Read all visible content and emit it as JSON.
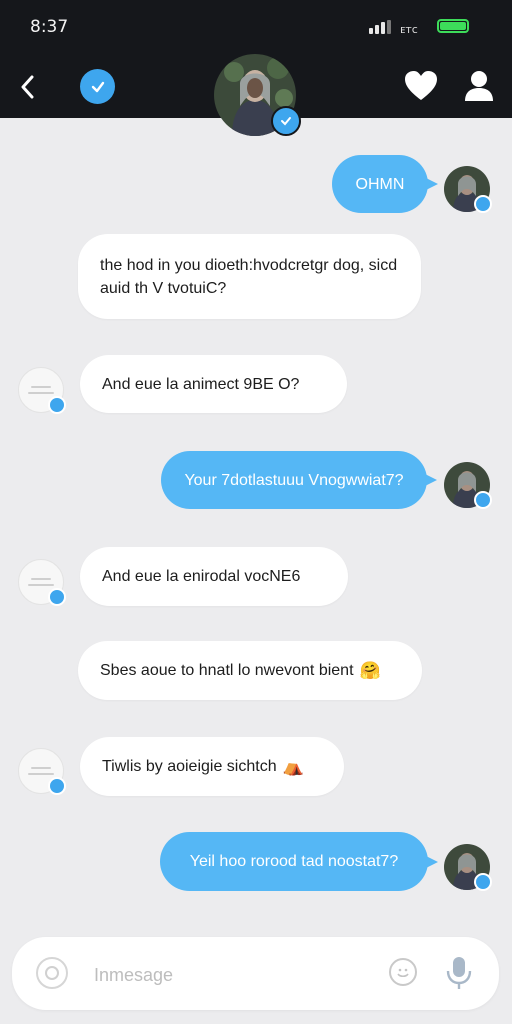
{
  "status_bar": {
    "time": "8:37",
    "carrier": "ᴇᴛᴄ"
  },
  "header": {
    "back_icon": "chevron-left-icon",
    "left_badge_icon": "verified-badge-icon",
    "right_icons": [
      "heart-icon",
      "profile-icon"
    ]
  },
  "colors": {
    "topbar": "#15171b",
    "accent_blue": "#55b7f5",
    "badge_blue": "#3ea6ee",
    "background": "#ececee",
    "battery": "#3ddc5a"
  },
  "messages": [
    {
      "direction": "out",
      "text": "OHMN"
    },
    {
      "direction": "in",
      "text": "the hod in you dioeth:hvodcretgr dog, sicd auid th V tvotuiC?"
    },
    {
      "direction": "in",
      "text": "And eue la animect 9BE O?"
    },
    {
      "direction": "out",
      "text": "Your 7dotlastuuu Vnogwwiat7?"
    },
    {
      "direction": "in",
      "text": "And eue la enirodal vocNE6"
    },
    {
      "direction": "in",
      "text": "Sbes aoue to hnatl lo nwevont bient",
      "emoji": "🤗"
    },
    {
      "direction": "in",
      "text": "Tiwlis by aoieigie sichtch",
      "emoji": "⛺"
    },
    {
      "direction": "out",
      "text": "Yeil hoo rorood tad noostat7?"
    }
  ],
  "composer": {
    "placeholder": "Inmesage",
    "attach_icon": "attach-icon",
    "emoji_icon": "emoji-icon",
    "mic_icon": "microphone-icon"
  }
}
